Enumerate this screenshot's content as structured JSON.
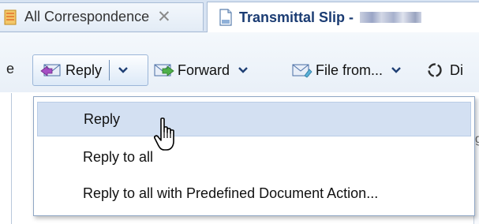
{
  "tabs": [
    {
      "label": "All Correspondence",
      "close": "✕",
      "icon": "document-stack-icon"
    },
    {
      "label": "Transmittal Slip -",
      "icon": "document-icon",
      "redacted": true
    }
  ],
  "toolbar": {
    "partial_left": "e",
    "reply": {
      "label": "Reply",
      "icon": "reply-envelope-icon",
      "dropdown_icon": "chevron-down-icon"
    },
    "forward": {
      "label": "Forward",
      "icon": "forward-envelope-icon"
    },
    "file_from": {
      "label": "File from...",
      "icon": "file-envelope-icon"
    },
    "partial_right": {
      "label": "Di",
      "icon": "refresh-circle-icon"
    }
  },
  "reply_menu": {
    "items": [
      {
        "label": "Reply",
        "highlighted": true
      },
      {
        "label": "Reply to all"
      },
      {
        "label": "Reply to all with Predefined Document Action..."
      }
    ]
  },
  "content_partial": "g",
  "colors": {
    "tab_strip": "#d7e3f2",
    "active_tab_text": "#1b3c73",
    "menu_highlight": "#d3e0f2",
    "button_border": "#9bb6d8"
  }
}
